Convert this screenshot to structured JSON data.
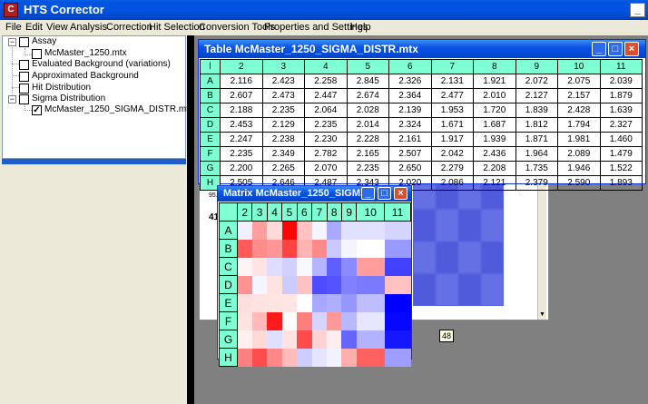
{
  "app": {
    "title": "HTS Corrector",
    "icon_letter": "C"
  },
  "window_buttons": {
    "minimize": "_",
    "maximize": "□",
    "close": "×"
  },
  "menu": [
    "File",
    "Edit",
    "View",
    "Analysis",
    "Correction",
    "Hit Selection",
    "Conversion Tools",
    "Properties and Settings",
    "Help"
  ],
  "tree": [
    {
      "label": "Assay",
      "expander": "−",
      "checked": false
    },
    {
      "label": "McMaster_1250.mtx",
      "checked": false
    },
    {
      "label": "Evaluated Background (variations)",
      "checked": false
    },
    {
      "label": "Approximated Background",
      "checked": false
    },
    {
      "label": "Hit Distribution",
      "checked": false
    },
    {
      "label": "Sigma Distribution",
      "expander": "−",
      "checked": false
    },
    {
      "label": "McMaster_1250_SIGMA_DISTR.mtx",
      "checked": true
    }
  ],
  "table_window": {
    "title": "Table McMaster_1250_SIGMA_DISTR.mtx",
    "corner": "l",
    "columns": [
      "2",
      "3",
      "4",
      "5",
      "6",
      "7",
      "8",
      "9",
      "10",
      "11"
    ],
    "rows": [
      {
        "label": "A",
        "values": [
          "2.116",
          "2.423",
          "2.258",
          "2.845",
          "2.326",
          "2.131",
          "1.921",
          "2.072",
          "2.075",
          "2.039"
        ]
      },
      {
        "label": "B",
        "values": [
          "2.607",
          "2.473",
          "2.447",
          "2.674",
          "2.364",
          "2.477",
          "2.010",
          "2.127",
          "2.157",
          "1.879"
        ]
      },
      {
        "label": "C",
        "values": [
          "2.188",
          "2.235",
          "2.064",
          "2.028",
          "2.139",
          "1.953",
          "1.720",
          "1.839",
          "2.428",
          "1.639"
        ]
      },
      {
        "label": "D",
        "values": [
          "2.453",
          "2.129",
          "2.235",
          "2.014",
          "2.324",
          "1.671",
          "1.687",
          "1.812",
          "1.794",
          "2.327"
        ]
      },
      {
        "label": "E",
        "values": [
          "2.247",
          "2.238",
          "2.230",
          "2.228",
          "2.161",
          "1.917",
          "1.939",
          "1.871",
          "1.981",
          "1.460"
        ]
      },
      {
        "label": "F",
        "values": [
          "2.235",
          "2.349",
          "2.782",
          "2.165",
          "2.507",
          "2.042",
          "2.436",
          "1.964",
          "2.089",
          "1.479"
        ]
      },
      {
        "label": "G",
        "values": [
          "2.200",
          "2.265",
          "2.070",
          "2.235",
          "2.650",
          "2.279",
          "2.208",
          "1.735",
          "1.946",
          "1.522"
        ]
      },
      {
        "label": "H",
        "values": [
          "2.505",
          "2.646",
          "2.487",
          "2.343",
          "2.020",
          "2.086",
          "2.121",
          "2.379",
          "2.590",
          "1.893"
        ]
      }
    ]
  },
  "matrix_window": {
    "title": "Matrix McMaster_1250_SIGM...",
    "columns": [
      "2",
      "3",
      "4",
      "5",
      "6",
      "7",
      "8",
      "9",
      "10",
      "11"
    ],
    "rows": [
      "A",
      "B",
      "C",
      "D",
      "E",
      "F",
      "G",
      "H"
    ]
  },
  "background_window": {
    "label_95": "95.",
    "label_41": "41"
  },
  "tooltip": "48",
  "scroll_arrow": "▼"
}
